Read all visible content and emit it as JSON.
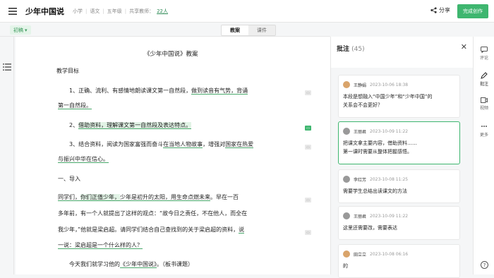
{
  "header": {
    "title": "少年中国说",
    "meta_grade": "小学",
    "meta_subject": "语文",
    "meta_level": "五年级",
    "meta_collab_prefix": "共享教师：",
    "meta_collab_count": "22人",
    "share_label": "分享",
    "done_label": "完成创作"
  },
  "toolbar": {
    "tag_label": "初稿",
    "seg_tabs": [
      "教案",
      "课件"
    ]
  },
  "document": {
    "heading": "《少年中国说》教案",
    "section_goal": "教学目标",
    "goal1_a": "1、正确、流利、有感情地朗读课文第一自然段，",
    "goal1_b": "做到读音有气势，背诵",
    "goal1_c": "第一自然段。",
    "goal2_a": "2、",
    "goal2_b": "借助资料，理解课文第一自然段及表达特点。",
    "goal3_a": "3、结合资料，阅读为国家富强而奋斗",
    "goal3_b": "在当地人物故事",
    "goal3_c": "，增强对",
    "goal3_d": "国家在热爱",
    "goal3_e": "与振兴中华在信心。",
    "section_intro": "一、导入",
    "intro1_a": "同学们，",
    "intro1_b": "你们正值少年，",
    "intro1_c": "少年是初升的太阳，",
    "intro1_d": "用生命点燃未来",
    "intro1_e": "。早在一百",
    "intro2": "多年前，有一个人就提出了这样的观点：“故今日之责任，不在他人，而全在",
    "intro3_a": "我少年，”他就是梁启超。请同学们结合自己查找到的关于梁启超的资料，",
    "intro3_b": "说",
    "intro4": "一说：梁启超是一个什么样的人？",
    "intro5_a": "今天我们就学习他的",
    "intro5_b": "《少年中国说》",
    "intro5_c": "。（板书课题）"
  },
  "annotations": {
    "title": "批注",
    "count": "(45)",
    "items": [
      {
        "name": "王静娟",
        "time": "2023-10-06 18:38",
        "lines": [
          "本段是想融入“中国少年”和“少年中国”的",
          "关系会不会更好？"
        ]
      },
      {
        "name": "王丽君",
        "time": "2023-10-09 11:22",
        "lines": [
          "把课文拿主要内容，借助资料……",
          "第一课时需要从整体把握感悟。"
        ]
      },
      {
        "name": "李红芳",
        "time": "2023-10-08 11:25",
        "lines": [
          "需要学生总结出读课文的方法"
        ]
      },
      {
        "name": "王丽君",
        "time": "2023-10-09 11:22",
        "lines": [
          "这里还需要改，需要表达"
        ]
      },
      {
        "name": "田立立",
        "time": "2023-10-08 06:16",
        "lines": [
          "的"
        ]
      }
    ]
  },
  "right_rail": {
    "items": [
      "评论",
      "批注",
      "视频",
      "更多"
    ]
  },
  "colors": {
    "accent": "#3eb66f",
    "underline": "#49a86b",
    "highlight": "#e2f3e6"
  }
}
